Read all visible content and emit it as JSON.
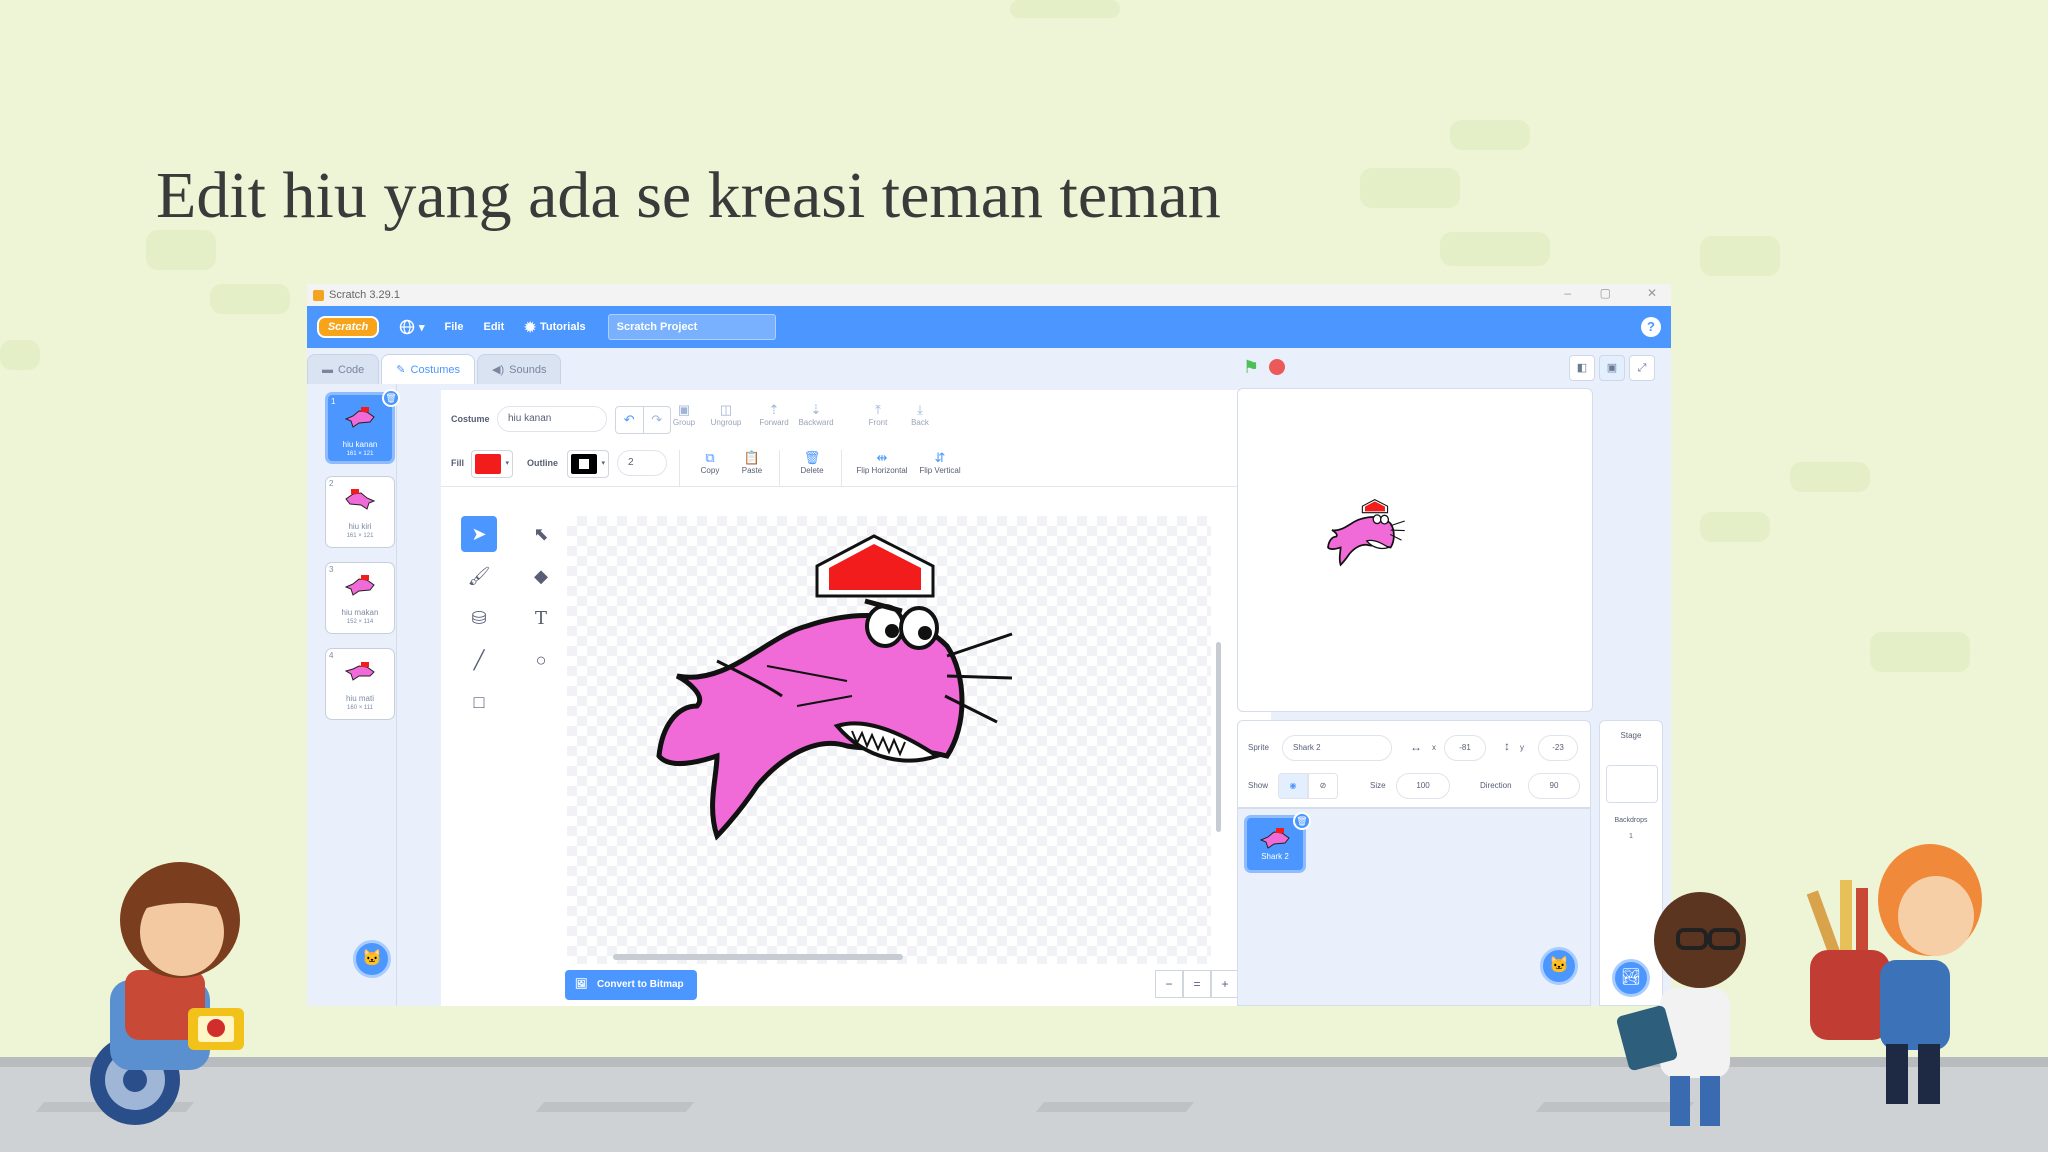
{
  "slide": {
    "title": "Edit hiu yang ada se kreasi teman teman"
  },
  "window": {
    "title": "Scratch 3.29.1",
    "controls": [
      "–",
      "▢",
      "✕"
    ]
  },
  "menubar": {
    "logo": "Scratch",
    "file": "File",
    "edit": "Edit",
    "tutorials": "Tutorials",
    "project_title": "Scratch Project",
    "help": "?"
  },
  "tabs": [
    {
      "label": "Code",
      "icon": "code-icon"
    },
    {
      "label": "Costumes",
      "icon": "brush-icon"
    },
    {
      "label": "Sounds",
      "icon": "speaker-icon"
    }
  ],
  "costumes": [
    {
      "num": "1",
      "name": "hiu kanan",
      "size": "161 × 121"
    },
    {
      "num": "2",
      "name": "hiu kiri",
      "size": "161 × 121"
    },
    {
      "num": "3",
      "name": "hiu makan",
      "size": "152 × 114"
    },
    {
      "num": "4",
      "name": "hiu mati",
      "size": "160 × 111"
    }
  ],
  "paint_editor": {
    "costume_label": "Costume",
    "costume_name": "hiu kanan",
    "fill_label": "Fill",
    "outline_label": "Outline",
    "outline_width": "2",
    "fill_color": "#f21c1c",
    "outline_color": "#000000",
    "buttons": {
      "group": "Group",
      "ungroup": "Ungroup",
      "forward": "Forward",
      "backward": "Backward",
      "front": "Front",
      "back": "Back",
      "copy": "Copy",
      "paste": "Paste",
      "delete": "Delete",
      "flip_h": "Flip Horizontal",
      "flip_v": "Flip Vertical"
    },
    "convert_button": "Convert to Bitmap",
    "zoom": [
      "−",
      "=",
      "+"
    ]
  },
  "sprite_info": {
    "sprite_label": "Sprite",
    "sprite_name": "Shark 2",
    "x_label": "x",
    "x": "-81",
    "y_label": "y",
    "y": "-23",
    "show_label": "Show",
    "size_label": "Size",
    "size": "100",
    "direction_label": "Direction",
    "direction": "90"
  },
  "sprites": [
    {
      "name": "Shark 2"
    }
  ],
  "stage_pane": {
    "label": "Stage",
    "backdrops_label": "Backdrops",
    "backdrops_count": "1"
  },
  "colors": {
    "scratch_blue": "#4c97ff",
    "slide_bg": "#edf5d6",
    "shark_pink": "#f06ad8",
    "hat_red": "#f21c1c"
  }
}
